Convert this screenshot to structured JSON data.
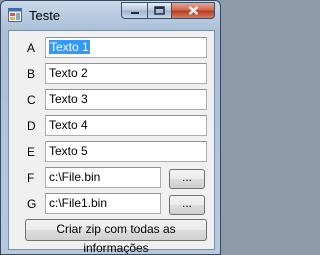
{
  "window": {
    "title": "Teste"
  },
  "rows": [
    {
      "label": "A",
      "value": "Texto 1"
    },
    {
      "label": "B",
      "value": "Texto 2"
    },
    {
      "label": "C",
      "value": "Texto 3"
    },
    {
      "label": "D",
      "value": "Texto 4"
    },
    {
      "label": "E",
      "value": "Texto 5"
    },
    {
      "label": "F",
      "value": "c:\\File.bin"
    },
    {
      "label": "G",
      "value": "c:\\File1.bin"
    }
  ],
  "browse_label": "...",
  "zip_button": "Criar zip com todas as informações"
}
